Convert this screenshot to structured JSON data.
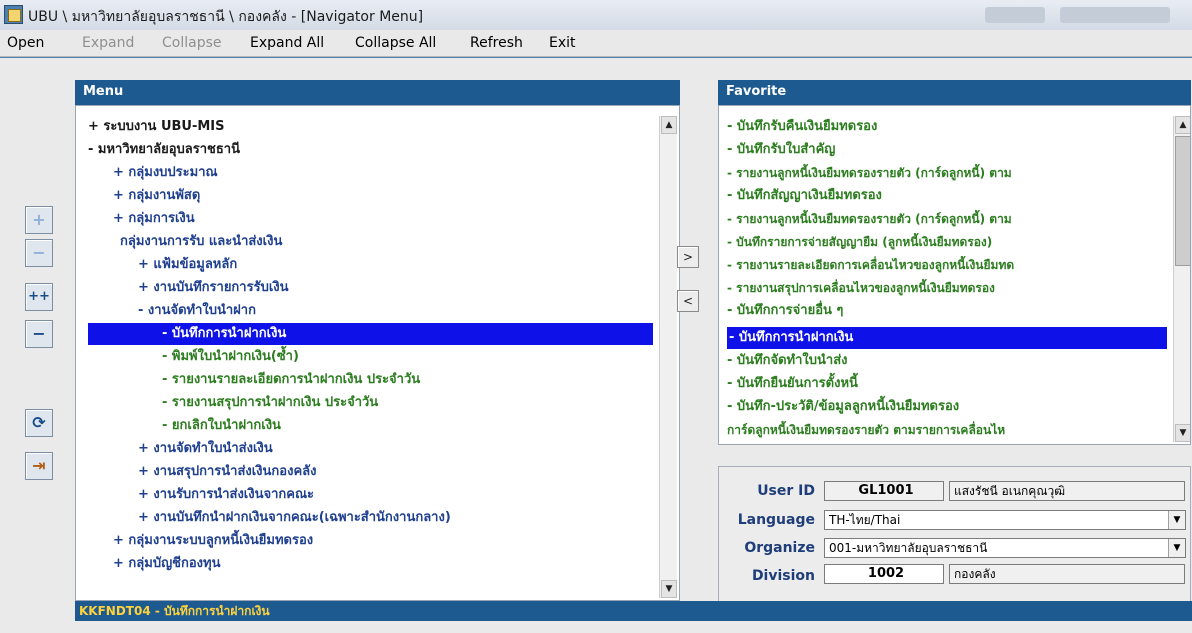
{
  "window": {
    "title": "UBU \\ มหาวิทยาลัยอุบลราชธานี \\ กองคลัง - [Navigator Menu]"
  },
  "menubar": {
    "items": [
      "Open",
      "Expand",
      "Collapse",
      "Expand All",
      "Collapse All",
      "Refresh",
      "Exit"
    ],
    "disabled": [
      "Expand",
      "Collapse"
    ]
  },
  "menu_panel": {
    "header": "Menu",
    "items": [
      "+ ระบบงาน UBU-MIS",
      "- มหาวิทยาลัยอุบลราชธานี",
      "+ กลุ่มงบประมาณ",
      "+ กลุ่มงานพัสดุ",
      "+ กลุ่มการเงิน",
      "กลุ่มงานการรับ และนำส่งเงิน",
      "+ แฟ้มข้อมูลหลัก",
      "+ งานบันทึกรายการรับเงิน",
      "- งานจัดทำใบนำฝาก",
      "- บันทึกการนำฝากเงิน",
      "- พิมพ์ใบนำฝากเงิน(ซ้ำ)",
      "- รายงานรายละเอียดการนำฝากเงิน ประจำวัน",
      "- รายงานสรุปการนำฝากเงิน ประจำวัน",
      "- ยกเลิกใบนำฝากเงิน",
      "+ งานจัดทำใบนำส่งเงิน",
      "+ งานสรุปการนำส่งเงินกองคลัง",
      "+ งานรับการนำส่งเงินจากคณะ",
      "+ งานบันทึกนำฝากเงินจากคณะ(เฉพาะสำนักงานกลาง)",
      "+ กลุ่มงานระบบลูกหนี้เงินยืมทดรอง",
      "+ กลุ่มบัญชีกองทุน"
    ]
  },
  "favorite_panel": {
    "header": "Favorite",
    "items": [
      "- บันทึกรับคืนเงินยืมทดรอง",
      "- บันทึกรับใบสำคัญ",
      "- รายงานลูกหนี้เงินยืมทดรองรายตัว (การ์ดลูกหนี้) ตาม",
      "- บันทึกสัญญาเงินยืมทดรอง",
      "- รายงานลูกหนี้เงินยืมทดรองรายตัว (การ์ดลูกหนี้) ตาม",
      "- บันทึกรายการจ่ายสัญญายืม (ลูกหนี้เงินยืมทดรอง)",
      "- รายงานรายละเอียดการเคลื่อนไหวของลูกหนี้เงินยืมทด",
      "- รายงานสรุปการเคลื่อนไหวของลูกหนี้เงินยืมทดรอง",
      "- บันทึกการจ่ายอื่น ๆ",
      "- บันทึกการนำฝากเงิน",
      "- บันทึกจัดทำใบนำส่ง",
      "- บันทึกยืนยันการตั้งหนี้",
      "- บันทึก-ประวัติ/ข้อมูลลูกหนี้เงินยืมทดรอง",
      "การ์ดลูกหนี้เงินยืมทดรองรายตัว ตามรายการเคลื่อนไห"
    ]
  },
  "transfer": {
    "add": ">",
    "remove": "<"
  },
  "user_info": {
    "user_id_label": "User ID",
    "user_id": "GL1001",
    "user_name": "แสงรัชนี อเนกคุณวุฒิ",
    "language_label": "Language",
    "language": "TH-ไทย/Thai",
    "organize_label": "Organize",
    "organize": "001-มหาวิทยาลัยอุบลราชธานี",
    "division_label": "Division",
    "division_code": "1002",
    "division_name": "กองคลัง"
  },
  "status": "KKFNDT04 - บันทึกการนำฝากเงิน",
  "colors": {
    "header_bg": "#1d5a90",
    "selection": "#0f12e8",
    "tree_green": "#2c7d1f",
    "status_text": "#ffd23c"
  }
}
